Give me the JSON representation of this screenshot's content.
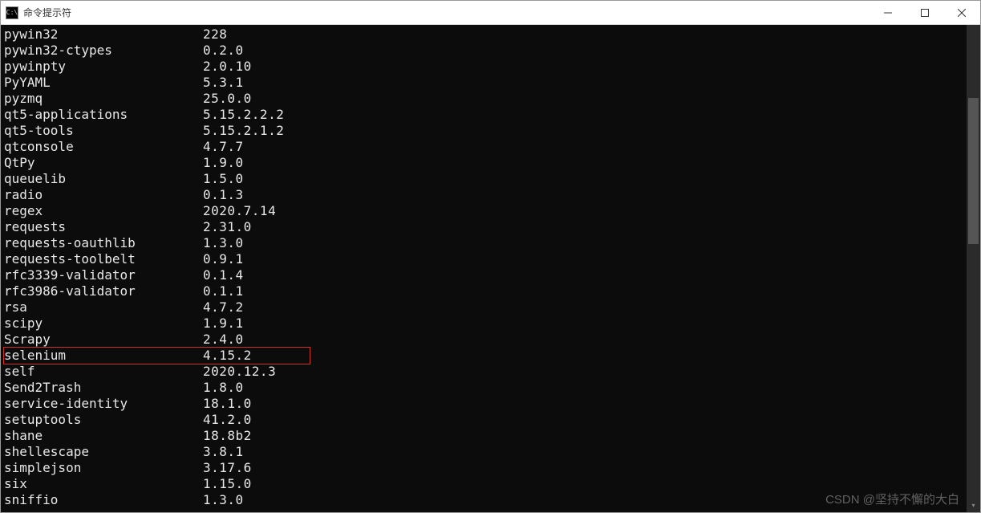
{
  "window": {
    "icon_text": "C:\\",
    "title": "命令提示符"
  },
  "packages": [
    {
      "name": "pywin32",
      "version": "228",
      "highlighted": false
    },
    {
      "name": "pywin32-ctypes",
      "version": "0.2.0",
      "highlighted": false
    },
    {
      "name": "pywinpty",
      "version": "2.0.10",
      "highlighted": false
    },
    {
      "name": "PyYAML",
      "version": "5.3.1",
      "highlighted": false
    },
    {
      "name": "pyzmq",
      "version": "25.0.0",
      "highlighted": false
    },
    {
      "name": "qt5-applications",
      "version": "5.15.2.2.2",
      "highlighted": false
    },
    {
      "name": "qt5-tools",
      "version": "5.15.2.1.2",
      "highlighted": false
    },
    {
      "name": "qtconsole",
      "version": "4.7.7",
      "highlighted": false
    },
    {
      "name": "QtPy",
      "version": "1.9.0",
      "highlighted": false
    },
    {
      "name": "queuelib",
      "version": "1.5.0",
      "highlighted": false
    },
    {
      "name": "radio",
      "version": "0.1.3",
      "highlighted": false
    },
    {
      "name": "regex",
      "version": "2020.7.14",
      "highlighted": false
    },
    {
      "name": "requests",
      "version": "2.31.0",
      "highlighted": false
    },
    {
      "name": "requests-oauthlib",
      "version": "1.3.0",
      "highlighted": false
    },
    {
      "name": "requests-toolbelt",
      "version": "0.9.1",
      "highlighted": false
    },
    {
      "name": "rfc3339-validator",
      "version": "0.1.4",
      "highlighted": false
    },
    {
      "name": "rfc3986-validator",
      "version": "0.1.1",
      "highlighted": false
    },
    {
      "name": "rsa",
      "version": "4.7.2",
      "highlighted": false
    },
    {
      "name": "scipy",
      "version": "1.9.1",
      "highlighted": false
    },
    {
      "name": "Scrapy",
      "version": "2.4.0",
      "highlighted": false
    },
    {
      "name": "selenium",
      "version": "4.15.2",
      "highlighted": true
    },
    {
      "name": "self",
      "version": "2020.12.3",
      "highlighted": false
    },
    {
      "name": "Send2Trash",
      "version": "1.8.0",
      "highlighted": false
    },
    {
      "name": "service-identity",
      "version": "18.1.0",
      "highlighted": false
    },
    {
      "name": "setuptools",
      "version": "41.2.0",
      "highlighted": false
    },
    {
      "name": "shane",
      "version": "18.8b2",
      "highlighted": false
    },
    {
      "name": "shellescape",
      "version": "3.8.1",
      "highlighted": false
    },
    {
      "name": "simplejson",
      "version": "3.17.6",
      "highlighted": false
    },
    {
      "name": "six",
      "version": "1.15.0",
      "highlighted": false
    },
    {
      "name": "sniffio",
      "version": "1.3.0",
      "highlighted": false
    }
  ],
  "watermark": "CSDN @坚持不懈的大白"
}
